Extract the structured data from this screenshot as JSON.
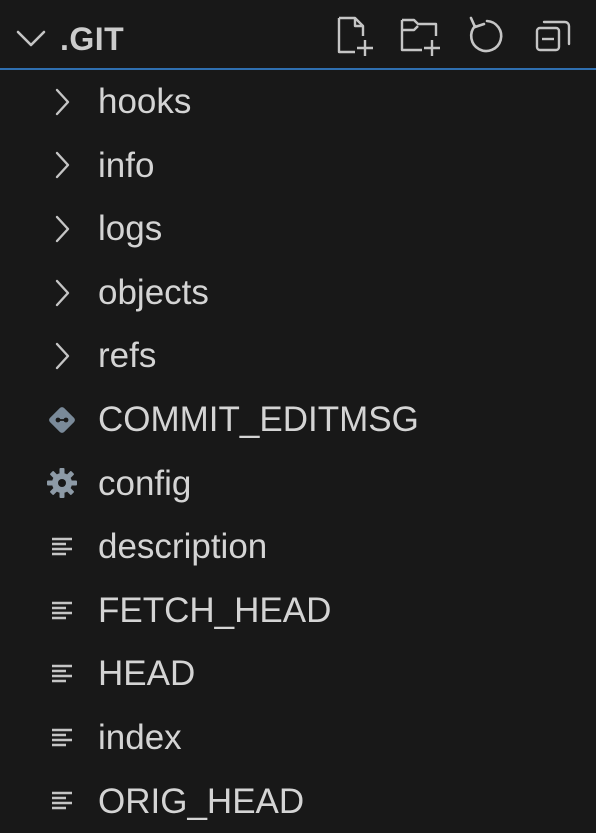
{
  "explorer": {
    "section_title": ".GIT",
    "actions": [
      {
        "name": "new-file-icon"
      },
      {
        "name": "new-folder-icon"
      },
      {
        "name": "refresh-icon"
      },
      {
        "name": "collapse-all-icon"
      }
    ]
  },
  "tree": {
    "folders": [
      {
        "label": "hooks",
        "icon": "chevron-right-icon"
      },
      {
        "label": "info",
        "icon": "chevron-right-icon"
      },
      {
        "label": "logs",
        "icon": "chevron-right-icon"
      },
      {
        "label": "objects",
        "icon": "chevron-right-icon"
      },
      {
        "label": "refs",
        "icon": "chevron-right-icon"
      }
    ],
    "files": [
      {
        "label": "COMMIT_EDITMSG",
        "icon": "git-icon"
      },
      {
        "label": "config",
        "icon": "gear-icon"
      },
      {
        "label": "description",
        "icon": "text-file-icon"
      },
      {
        "label": "FETCH_HEAD",
        "icon": "text-file-icon"
      },
      {
        "label": "HEAD",
        "icon": "text-file-icon"
      },
      {
        "label": "index",
        "icon": "text-file-icon"
      },
      {
        "label": "ORIG_HEAD",
        "icon": "text-file-icon"
      }
    ]
  },
  "colors": {
    "background": "#181818",
    "text": "#d4d4d4",
    "focus_border": "#2f6fb0",
    "icon": "#c5c5c5",
    "git_icon": "#7a8a99",
    "gear_icon": "#8d9aa6"
  }
}
